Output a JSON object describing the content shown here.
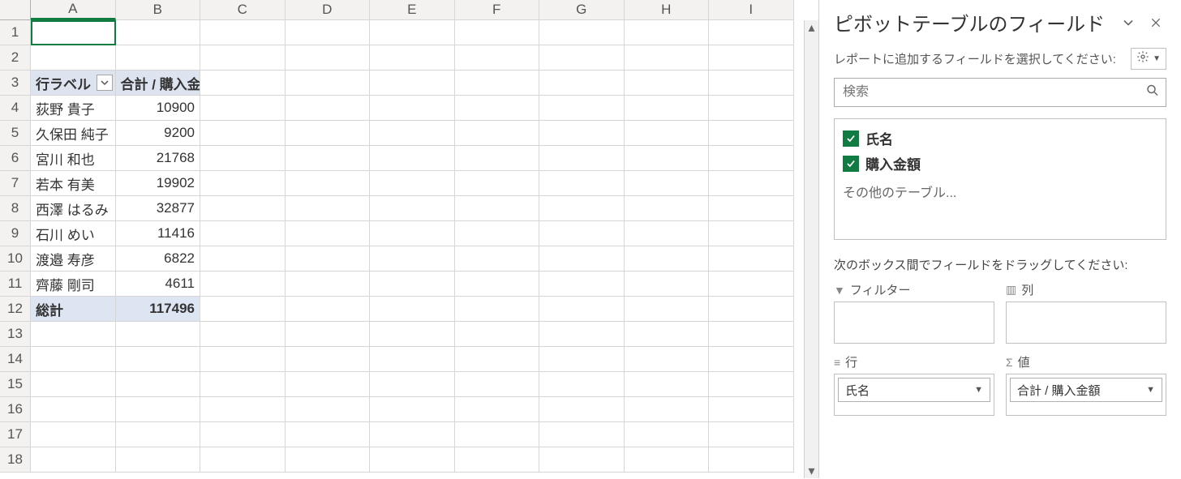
{
  "spreadsheet": {
    "columns": [
      "A",
      "B",
      "C",
      "D",
      "E",
      "F",
      "G",
      "H",
      "I"
    ],
    "row_count": 18,
    "pivot": {
      "header_row_label": "行ラベル",
      "header_value": "合計 / 購入金額",
      "rows": [
        {
          "label": "荻野 貴子",
          "value": "10900"
        },
        {
          "label": "久保田 純子",
          "value": "9200"
        },
        {
          "label": "宮川 和也",
          "value": "21768"
        },
        {
          "label": "若本 有美",
          "value": "19902"
        },
        {
          "label": "西澤 はるみ",
          "value": "32877"
        },
        {
          "label": "石川 めい",
          "value": "11416"
        },
        {
          "label": "渡邉 寿彦",
          "value": "6822"
        },
        {
          "label": "齊藤 剛司",
          "value": "4611"
        }
      ],
      "total_label": "総計",
      "total_value": "117496"
    }
  },
  "pane": {
    "title": "ピボットテーブルのフィールド",
    "subtitle": "レポートに追加するフィールドを選択してください:",
    "search_placeholder": "検索",
    "fields": [
      {
        "name": "氏名",
        "checked": true
      },
      {
        "name": "購入金額",
        "checked": true
      }
    ],
    "other_tables": "その他のテーブル...",
    "drag_hint": "次のボックス間でフィールドをドラッグしてください:",
    "areas": {
      "filter_label": "フィルター",
      "columns_label": "列",
      "rows_label": "行",
      "values_label": "値",
      "rows_items": [
        "氏名"
      ],
      "values_items": [
        "合計 / 購入金額"
      ]
    }
  }
}
